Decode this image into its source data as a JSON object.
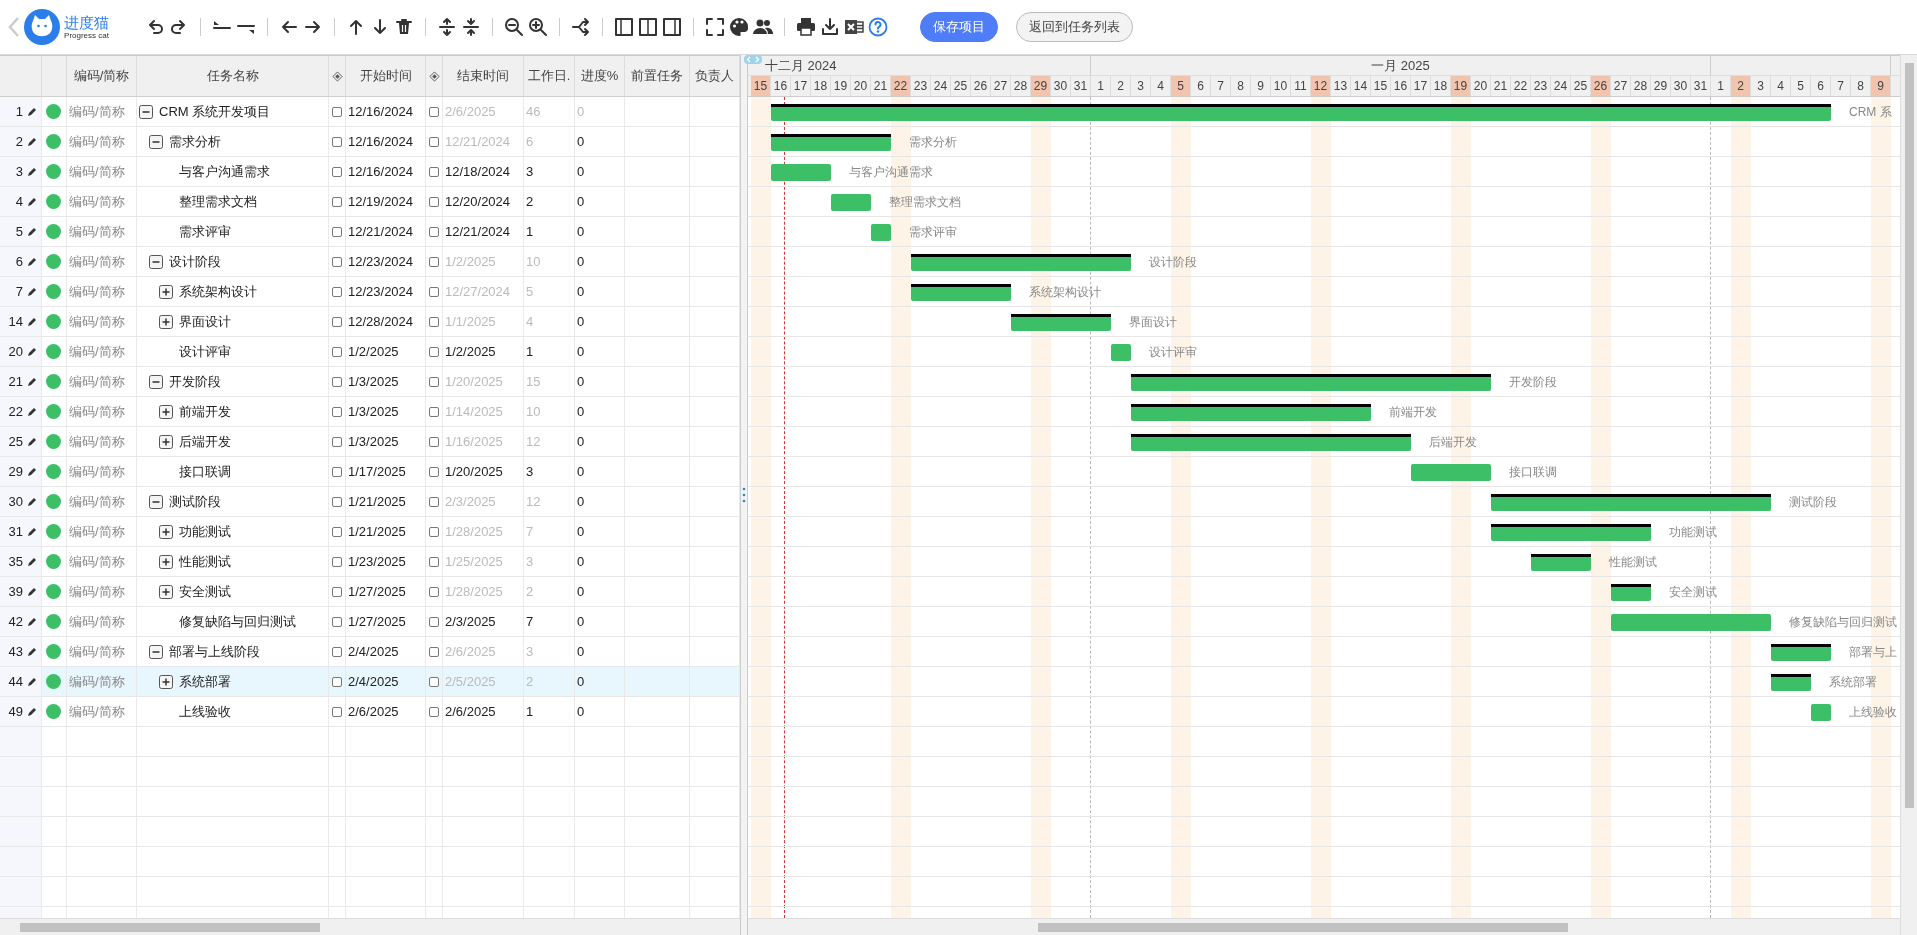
{
  "toolbar": {
    "logo": {
      "name": "进度猫",
      "subtitle": "Progress cat"
    },
    "buttons": [
      {
        "label": "保存项目",
        "kind": "primary"
      },
      {
        "label": "返回到任务列表",
        "kind": "secondary"
      }
    ]
  },
  "table": {
    "columns": [
      {
        "kind": "text",
        "label": "编码/简称"
      },
      {
        "kind": "text",
        "label": "任务名称"
      },
      {
        "kind": "milestone"
      },
      {
        "kind": "text",
        "label": "开始时间"
      },
      {
        "kind": "milestone"
      },
      {
        "kind": "text",
        "label": "结束时间"
      },
      {
        "kind": "text",
        "label": "工作日."
      },
      {
        "kind": "text",
        "label": "进度%"
      },
      {
        "kind": "text",
        "label": "前置任务"
      },
      {
        "kind": "text",
        "label": "负责人"
      }
    ],
    "rows": [
      {
        "num": "1",
        "code": "编码/简称",
        "name": "CRM 系统开发项目",
        "kind": "group",
        "expanded": true,
        "start_locked": false,
        "start": "12/16/2024",
        "end_locked": false,
        "end": "2/6/2025",
        "duration": "46",
        "progress": "0",
        "computed": true,
        "progress_computed": true,
        "selected": false,
        "bar_label": "CRM 系",
        "children": [
          {
            "num": "2",
            "code": "编码/简称",
            "name": "需求分析",
            "kind": "group",
            "expanded": true,
            "start_locked": false,
            "start": "12/16/2024",
            "end_locked": false,
            "end": "12/21/2024",
            "duration": "6",
            "progress": "0",
            "computed": true,
            "progress_computed": false,
            "selected": false,
            "bar_label": "需求分析",
            "children": [
              {
                "num": "3",
                "code": "编码/简称",
                "name": "与客户沟通需求",
                "kind": "task",
                "start_locked": false,
                "start": "12/16/2024",
                "end_locked": false,
                "end": "12/18/2024",
                "duration": "3",
                "progress": "0",
                "computed": false,
                "progress_computed": false,
                "selected": false,
                "bar_label": "与客户沟通需求"
              },
              {
                "num": "4",
                "code": "编码/简称",
                "name": "整理需求文档",
                "kind": "task",
                "start_locked": false,
                "start": "12/19/2024",
                "end_locked": false,
                "end": "12/20/2024",
                "duration": "2",
                "progress": "0",
                "computed": false,
                "progress_computed": false,
                "selected": false,
                "bar_label": "整理需求文档"
              },
              {
                "num": "5",
                "code": "编码/简称",
                "name": "需求评审",
                "kind": "task",
                "start_locked": false,
                "start": "12/21/2024",
                "end_locked": false,
                "end": "12/21/2024",
                "duration": "1",
                "progress": "0",
                "computed": false,
                "progress_computed": false,
                "selected": false,
                "bar_label": "需求评审"
              }
            ]
          },
          {
            "num": "6",
            "code": "编码/简称",
            "name": "设计阶段",
            "kind": "group",
            "expanded": true,
            "start_locked": false,
            "start": "12/23/2024",
            "end_locked": false,
            "end": "1/2/2025",
            "duration": "10",
            "progress": "0",
            "computed": true,
            "progress_computed": false,
            "selected": false,
            "bar_label": "设计阶段",
            "children": [
              {
                "num": "7",
                "code": "编码/简称",
                "name": "系统架构设计",
                "kind": "group",
                "expanded": false,
                "start_locked": false,
                "start": "12/23/2024",
                "end_locked": false,
                "end": "12/27/2024",
                "duration": "5",
                "progress": "0",
                "computed": true,
                "progress_computed": false,
                "selected": false,
                "bar_label": "系统架构设计"
              },
              {
                "num": "14",
                "code": "编码/简称",
                "name": "界面设计",
                "kind": "group",
                "expanded": false,
                "start_locked": false,
                "start": "12/28/2024",
                "end_locked": false,
                "end": "1/1/2025",
                "duration": "4",
                "progress": "0",
                "computed": true,
                "progress_computed": false,
                "selected": false,
                "bar_label": "界面设计"
              },
              {
                "num": "20",
                "code": "编码/简称",
                "name": "设计评审",
                "kind": "task",
                "start_locked": false,
                "start": "1/2/2025",
                "end_locked": false,
                "end": "1/2/2025",
                "duration": "1",
                "progress": "0",
                "computed": false,
                "progress_computed": false,
                "selected": false,
                "bar_label": "设计评审"
              }
            ]
          },
          {
            "num": "21",
            "code": "编码/简称",
            "name": "开发阶段",
            "kind": "group",
            "expanded": true,
            "start_locked": false,
            "start": "1/3/2025",
            "end_locked": false,
            "end": "1/20/2025",
            "duration": "15",
            "progress": "0",
            "computed": true,
            "progress_computed": false,
            "selected": false,
            "bar_label": "开发阶段",
            "children": [
              {
                "num": "22",
                "code": "编码/简称",
                "name": "前端开发",
                "kind": "group",
                "expanded": false,
                "start_locked": false,
                "start": "1/3/2025",
                "end_locked": false,
                "end": "1/14/2025",
                "duration": "10",
                "progress": "0",
                "computed": true,
                "progress_computed": false,
                "selected": false,
                "bar_label": "前端开发"
              },
              {
                "num": "25",
                "code": "编码/简称",
                "name": "后端开发",
                "kind": "group",
                "expanded": false,
                "start_locked": false,
                "start": "1/3/2025",
                "end_locked": false,
                "end": "1/16/2025",
                "duration": "12",
                "progress": "0",
                "computed": true,
                "progress_computed": false,
                "selected": false,
                "bar_label": "后端开发"
              },
              {
                "num": "29",
                "code": "编码/简称",
                "name": "接口联调",
                "kind": "task",
                "start_locked": false,
                "start": "1/17/2025",
                "end_locked": false,
                "end": "1/20/2025",
                "duration": "3",
                "progress": "0",
                "computed": false,
                "progress_computed": false,
                "selected": false,
                "bar_label": "接口联调"
              }
            ]
          },
          {
            "num": "30",
            "code": "编码/简称",
            "name": "测试阶段",
            "kind": "group",
            "expanded": true,
            "start_locked": false,
            "start": "1/21/2025",
            "end_locked": false,
            "end": "2/3/2025",
            "duration": "12",
            "progress": "0",
            "computed": true,
            "progress_computed": false,
            "selected": false,
            "bar_label": "测试阶段",
            "children": [
              {
                "num": "31",
                "code": "编码/简称",
                "name": "功能测试",
                "kind": "group",
                "expanded": false,
                "start_locked": false,
                "start": "1/21/2025",
                "end_locked": false,
                "end": "1/28/2025",
                "duration": "7",
                "progress": "0",
                "computed": true,
                "progress_computed": false,
                "selected": false,
                "bar_label": "功能测试"
              },
              {
                "num": "35",
                "code": "编码/简称",
                "name": "性能测试",
                "kind": "group",
                "expanded": false,
                "start_locked": false,
                "start": "1/23/2025",
                "end_locked": false,
                "end": "1/25/2025",
                "duration": "3",
                "progress": "0",
                "computed": true,
                "progress_computed": false,
                "selected": false,
                "bar_label": "性能测试"
              },
              {
                "num": "39",
                "code": "编码/简称",
                "name": "安全测试",
                "kind": "group",
                "expanded": false,
                "start_locked": false,
                "start": "1/27/2025",
                "end_locked": false,
                "end": "1/28/2025",
                "duration": "2",
                "progress": "0",
                "computed": true,
                "progress_computed": false,
                "selected": false,
                "bar_label": "安全测试"
              },
              {
                "num": "42",
                "code": "编码/简称",
                "name": "修复缺陷与回归测试",
                "kind": "task",
                "start_locked": false,
                "start": "1/27/2025",
                "end_locked": false,
                "end": "2/3/2025",
                "duration": "7",
                "progress": "0",
                "computed": false,
                "progress_computed": false,
                "selected": false,
                "bar_label": "修复缺陷与回归测试"
              }
            ]
          },
          {
            "num": "43",
            "code": "编码/简称",
            "name": "部署与上线阶段",
            "kind": "group",
            "expanded": true,
            "start_locked": false,
            "start": "2/4/2025",
            "end_locked": false,
            "end": "2/6/2025",
            "duration": "3",
            "progress": "0",
            "computed": true,
            "progress_computed": false,
            "selected": false,
            "bar_label": "部署与上",
            "children": [
              {
                "num": "44",
                "code": "编码/简称",
                "name": "系统部署",
                "kind": "group",
                "expanded": false,
                "start_locked": false,
                "start": "2/4/2025",
                "end_locked": false,
                "end": "2/5/2025",
                "duration": "2",
                "progress": "0",
                "computed": true,
                "progress_computed": false,
                "selected": true,
                "bar_label": "系统部署"
              },
              {
                "num": "49",
                "code": "编码/简称",
                "name": "上线验收",
                "kind": "task",
                "start_locked": false,
                "start": "2/6/2025",
                "end_locked": false,
                "end": "2/6/2025",
                "duration": "1",
                "progress": "0",
                "computed": false,
                "progress_computed": false,
                "selected": false,
                "bar_label": "上线验收"
              }
            ]
          }
        ]
      }
    ]
  },
  "timeline": {
    "months": [
      {
        "label": "十二月 2024",
        "days": [
          {
            "label": "15",
            "highlighted": true
          },
          {
            "label": "16",
            "highlighted": false
          },
          {
            "label": "17",
            "highlighted": false
          },
          {
            "label": "18",
            "highlighted": false
          },
          {
            "label": "19",
            "highlighted": false
          },
          {
            "label": "20",
            "highlighted": false
          },
          {
            "label": "21",
            "highlighted": false
          },
          {
            "label": "22",
            "highlighted": true
          },
          {
            "label": "23",
            "highlighted": false
          },
          {
            "label": "24",
            "highlighted": false
          },
          {
            "label": "25",
            "highlighted": false
          },
          {
            "label": "26",
            "highlighted": false
          },
          {
            "label": "27",
            "highlighted": false
          },
          {
            "label": "28",
            "highlighted": false
          },
          {
            "label": "29",
            "highlighted": true
          },
          {
            "label": "30",
            "highlighted": false
          },
          {
            "label": "31",
            "highlighted": false
          }
        ]
      },
      {
        "label": "一月 2025",
        "days": [
          {
            "label": "1",
            "highlighted": false
          },
          {
            "label": "2",
            "highlighted": false
          },
          {
            "label": "3",
            "highlighted": false
          },
          {
            "label": "4",
            "highlighted": false
          },
          {
            "label": "5",
            "highlighted": true
          },
          {
            "label": "6",
            "highlighted": false
          },
          {
            "label": "7",
            "highlighted": false
          },
          {
            "label": "8",
            "highlighted": false
          },
          {
            "label": "9",
            "highlighted": false
          },
          {
            "label": "10",
            "highlighted": false
          },
          {
            "label": "11",
            "highlighted": false
          },
          {
            "label": "12",
            "highlighted": true
          },
          {
            "label": "13",
            "highlighted": false
          },
          {
            "label": "14",
            "highlighted": false
          },
          {
            "label": "15",
            "highlighted": false
          },
          {
            "label": "16",
            "highlighted": false
          },
          {
            "label": "17",
            "highlighted": false
          },
          {
            "label": "18",
            "highlighted": false
          },
          {
            "label": "19",
            "highlighted": true
          },
          {
            "label": "20",
            "highlighted": false
          },
          {
            "label": "21",
            "highlighted": false
          },
          {
            "label": "22",
            "highlighted": false
          },
          {
            "label": "23",
            "highlighted": false
          },
          {
            "label": "24",
            "highlighted": false
          },
          {
            "label": "25",
            "highlighted": false
          },
          {
            "label": "26",
            "highlighted": true
          },
          {
            "label": "27",
            "highlighted": false
          },
          {
            "label": "28",
            "highlighted": false
          },
          {
            "label": "29",
            "highlighted": false
          },
          {
            "label": "30",
            "highlighted": false
          },
          {
            "label": "31",
            "highlighted": false
          }
        ]
      },
      {
        "days": [
          {
            "label": "1",
            "highlighted": false
          },
          {
            "label": "2",
            "highlighted": true
          },
          {
            "label": "3",
            "highlighted": false
          },
          {
            "label": "4",
            "highlighted": false
          },
          {
            "label": "5",
            "highlighted": false
          },
          {
            "label": "6",
            "highlighted": false
          },
          {
            "label": "7",
            "highlighted": false
          },
          {
            "label": "8",
            "highlighted": false
          },
          {
            "label": "9",
            "highlighted": true
          }
        ]
      }
    ]
  }
}
